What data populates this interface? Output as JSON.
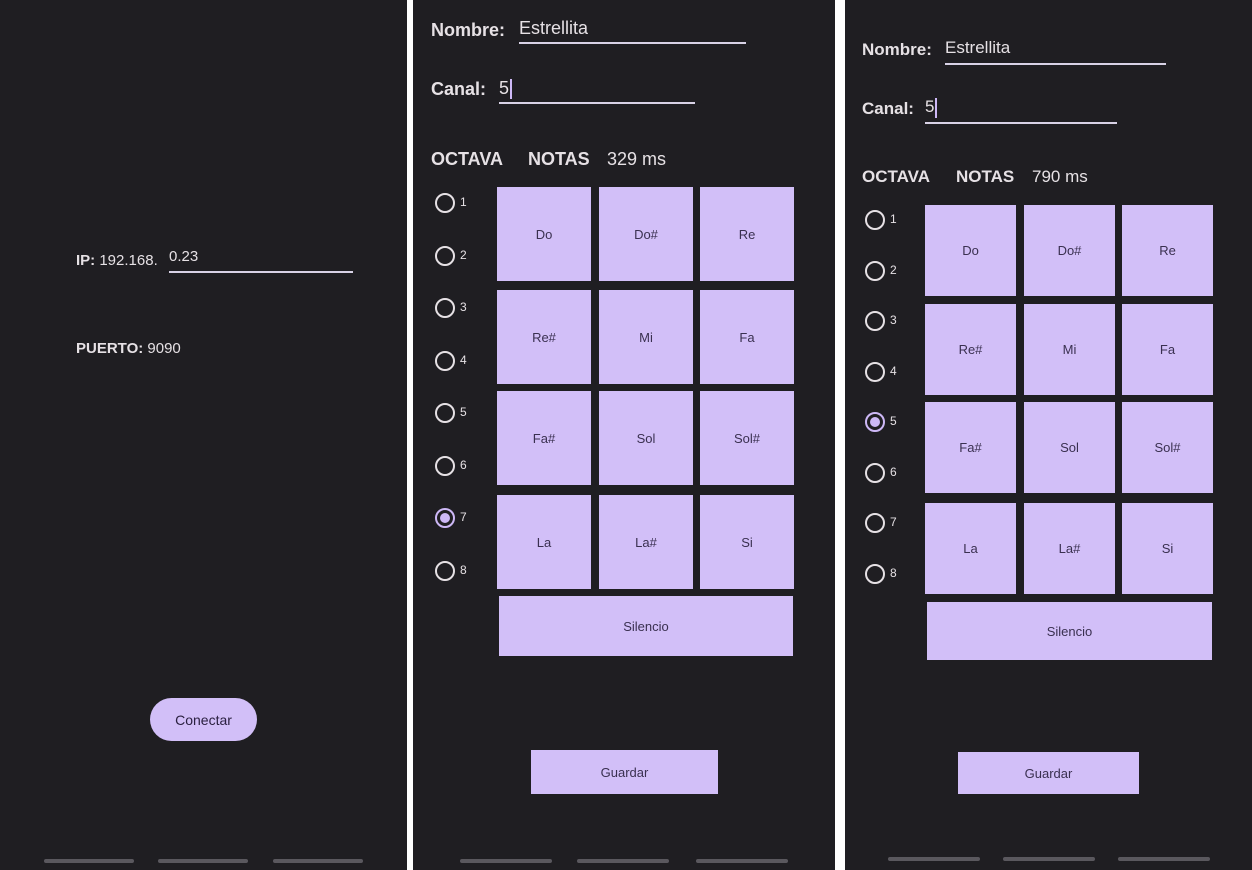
{
  "connect_screen": {
    "ip_label": "IP:",
    "ip_prefix": "192.168.",
    "ip_value": "0.23",
    "port_label": "PUERTO:",
    "port_value": "9090",
    "connect_button": "Conectar"
  },
  "editor_a": {
    "name_label": "Nombre:",
    "name_value": "Estrellita",
    "channel_label": "Canal:",
    "channel_value": "5",
    "octave_header": "OCTAVA",
    "notes_header": "NOTAS",
    "duration": "329 ms",
    "octaves": [
      "1",
      "2",
      "3",
      "4",
      "5",
      "6",
      "7",
      "8"
    ],
    "selected_octave": "7",
    "notes": [
      "Do",
      "Do#",
      "Re",
      "Re#",
      "Mi",
      "Fa",
      "Fa#",
      "Sol",
      "Sol#",
      "La",
      "La#",
      "Si"
    ],
    "silence_button": "Silencio",
    "save_button": "Guardar"
  },
  "editor_b": {
    "name_label": "Nombre:",
    "name_value": "Estrellita",
    "channel_label": "Canal:",
    "channel_value": "5",
    "octave_header": "OCTAVA",
    "notes_header": "NOTAS",
    "duration": "790 ms",
    "octaves": [
      "1",
      "2",
      "3",
      "4",
      "5",
      "6",
      "7",
      "8"
    ],
    "selected_octave": "5",
    "notes": [
      "Do",
      "Do#",
      "Re",
      "Re#",
      "Mi",
      "Fa",
      "Fa#",
      "Sol",
      "Sol#",
      "La",
      "La#",
      "Si"
    ],
    "silence_button": "Silencio",
    "save_button": "Guardar"
  },
  "colors": {
    "background": "#1f1e22",
    "accent": "#d2bff8",
    "text": "#e6e1e5"
  }
}
